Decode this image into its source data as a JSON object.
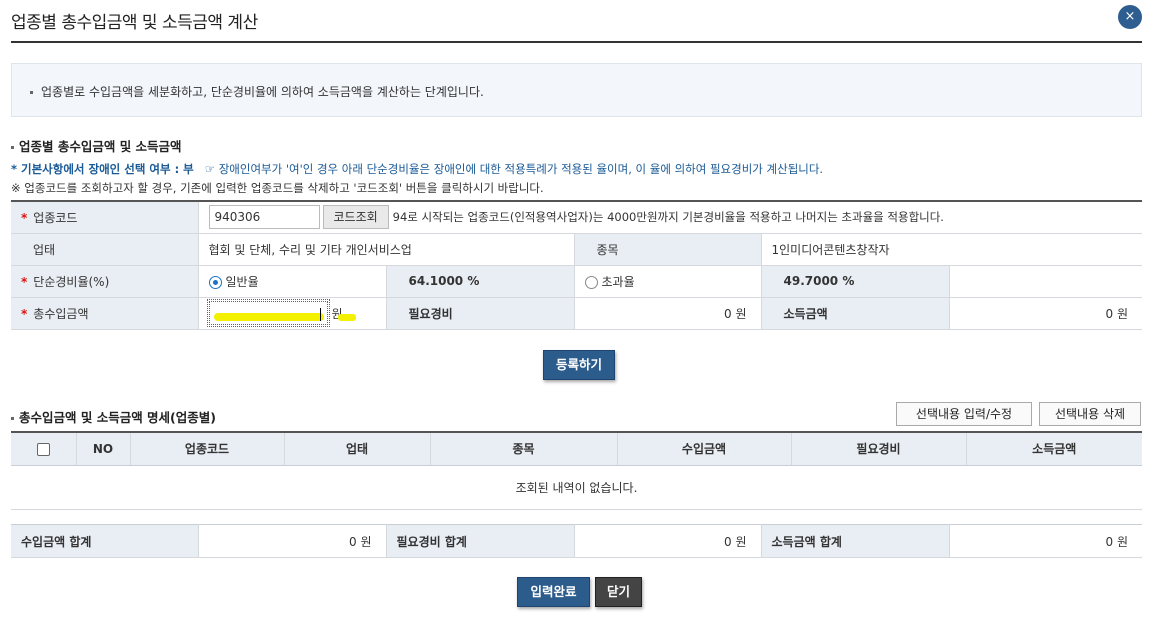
{
  "header": {
    "title": "업종별 총수입금액 및 소득금액 계산",
    "close_icon": "×"
  },
  "info": {
    "text": "업종별로 수입금액을 세분화하고, 단순경비율에 의하여 소득금액을 계산하는 단계입니다."
  },
  "section1": {
    "title": "업종별 총수입금액 및 소득금액",
    "note1_bold": "* 기본사항에서 장애인 선택 여부 : 부",
    "note1_rest": "☞ 장애인여부가 '여'인 경우 아래 단순경비율은 장애인에 대한 적용특례가 적용된 율이며, 이 율에 의하여 필요경비가 계산됩니다.",
    "note2": "※ 업종코드를 조회하고자 할 경우, 기존에 입력한 업종코드를 삭제하고 '코드조회' 버튼을 클릭하시기 바랍니다."
  },
  "form": {
    "code_label": "업종코드",
    "code_value": "940306",
    "code_button": "코드조회",
    "code_desc": "94로 시작되는 업종코드(인적용역사업자)는 4000만원까지 기본경비율을 적용하고 나머지는 초과율을 적용합니다.",
    "business_label": "업태",
    "business_value": "협회 및 단체, 수리 및 기타 개인서비스업",
    "item_label": "종목",
    "item_value": "1인미디어콘텐츠창작자",
    "rate_label": "단순경비율(%)",
    "rate_general_label": "일반율",
    "rate_general_value": "64.1000 %",
    "rate_excess_label": "초과율",
    "rate_excess_value": "49.7000 %",
    "revenue_label": "총수입금액",
    "revenue_unit": "원",
    "expense_label": "필요경비",
    "expense_value": "0 원",
    "income_label": "소득금액",
    "income_value": "0 원"
  },
  "register_button": "등록하기",
  "section2": {
    "title": "총수입금액 및 소득금액 명세(업종별)",
    "edit_button": "선택내용 입력/수정",
    "delete_button": "선택내용 삭제",
    "columns": [
      "NO",
      "업종코드",
      "업태",
      "종목",
      "수입금액",
      "필요경비",
      "소득금액"
    ],
    "empty_text": "조회된 내역이 없습니다."
  },
  "totals": {
    "revenue_label": "수입금액 합계",
    "revenue_value": "0 원",
    "expense_label": "필요경비 합계",
    "expense_value": "0 원",
    "income_label": "소득금액 합계",
    "income_value": "0 원"
  },
  "footer": {
    "complete_button": "입력완료",
    "close_button": "닫기"
  },
  "colors": {
    "accent": "#2c5c8c",
    "required": "#dd1111",
    "note": "#1a5a96",
    "header_bg": "#e9eef4"
  }
}
